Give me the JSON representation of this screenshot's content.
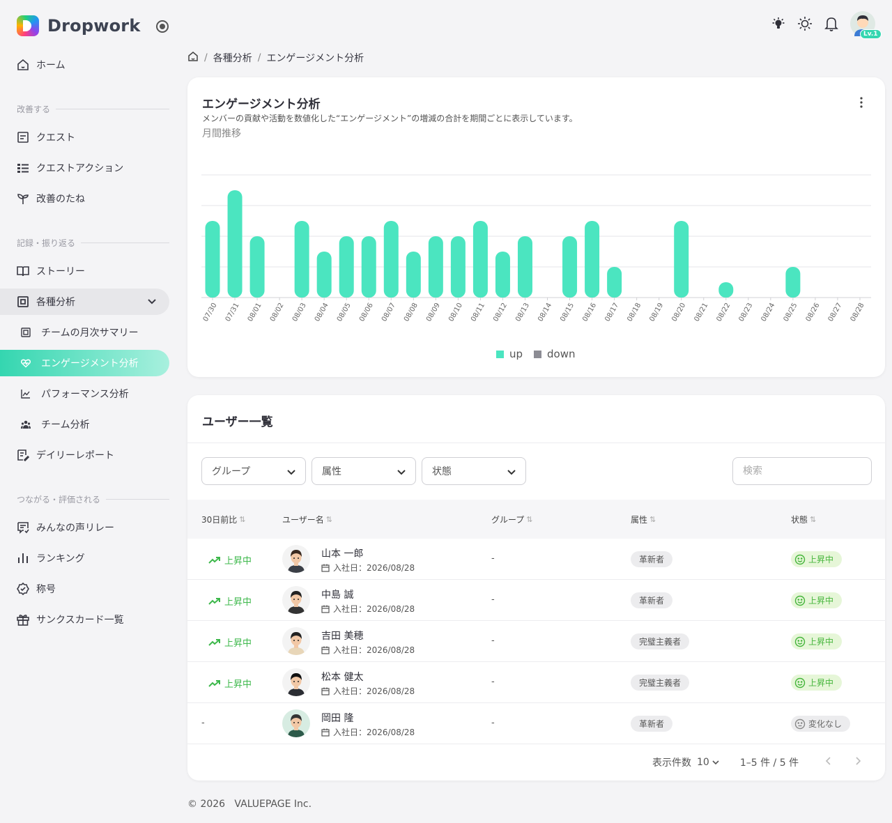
{
  "app": {
    "name": "Dropwork"
  },
  "colors": {
    "accent": "#34d6b0",
    "bar_up": "#4be5c0",
    "bar_down": "#8c8c94",
    "trend_up": "#3db84b"
  },
  "nav": {
    "home": "ホーム",
    "section_improve": "改善する",
    "quest": "クエスト",
    "quest_action": "クエストアクション",
    "seeds": "改善のたね",
    "section_record": "記録・振り返る",
    "story": "ストーリー",
    "analysis": "各種分析",
    "team_summary": "チームの月次サマリー",
    "engagement": "エンゲージメント分析",
    "performance": "パフォーマンス分析",
    "team_analysis": "チーム分析",
    "daily_report": "デイリーレポート",
    "section_connect": "つながる・評価される",
    "voice_relay": "みんなの声リレー",
    "ranking": "ランキング",
    "title_badge": "称号",
    "thanks_card": "サンクスカード一覧"
  },
  "user": {
    "level": "Lv.1"
  },
  "breadcrumb": {
    "parent": "各種分析",
    "current": "エンゲージメント分析"
  },
  "engagement_card": {
    "title": "エンゲージメント分析",
    "description": "メンバーの貢献や活動を数値化した“エンゲージメント”の増減の合計を期間ごとに表示しています。",
    "subtitle": "月間推移"
  },
  "chart_data": {
    "type": "bar",
    "categories": [
      "07/30",
      "07/31",
      "08/01",
      "08/02",
      "08/03",
      "08/04",
      "08/05",
      "08/06",
      "08/07",
      "08/08",
      "08/09",
      "08/10",
      "08/11",
      "08/12",
      "08/13",
      "08/14",
      "08/15",
      "08/16",
      "08/17",
      "08/18",
      "08/19",
      "08/20",
      "08/21",
      "08/22",
      "08/23",
      "08/24",
      "08/25",
      "08/26",
      "08/27",
      "08/28"
    ],
    "series": [
      {
        "name": "up",
        "color": "#4be5c0",
        "values": [
          5,
          7,
          4,
          0,
          5,
          3,
          4,
          4,
          5,
          3,
          4,
          4,
          5,
          3,
          4,
          0,
          4,
          5,
          2,
          0,
          0,
          5,
          0,
          1,
          0,
          0,
          2,
          0,
          0,
          0
        ]
      },
      {
        "name": "down",
        "color": "#8c8c94",
        "values": [
          0,
          0,
          0,
          0,
          0,
          0,
          0,
          0,
          0,
          0,
          0,
          0,
          0,
          0,
          0,
          0,
          0,
          0,
          0,
          0,
          0,
          0,
          0,
          0,
          0,
          0,
          0,
          0,
          0,
          0
        ]
      }
    ],
    "ylim": [
      0,
      8
    ],
    "grid": true,
    "legend": "bottom-center"
  },
  "users_card": {
    "title": "ユーザー一覧",
    "filters": {
      "group": "グループ",
      "attribute": "属性",
      "state": "状態"
    },
    "search_placeholder": "検索",
    "columns": {
      "change": "30日前比",
      "name": "ユーザー名",
      "group": "グループ",
      "attribute": "属性",
      "state": "状態"
    },
    "join_label": "入社日：",
    "rows": [
      {
        "trend": "上昇中",
        "name": "山本 一郎",
        "join": "2026/08/28",
        "group": "-",
        "attribute": "革新者",
        "state": "上昇中"
      },
      {
        "trend": "上昇中",
        "name": "中島 誠",
        "join": "2026/08/28",
        "group": "-",
        "attribute": "革新者",
        "state": "上昇中"
      },
      {
        "trend": "上昇中",
        "name": "吉田 美穂",
        "join": "2026/08/28",
        "group": "-",
        "attribute": "完璧主義者",
        "state": "上昇中"
      },
      {
        "trend": "上昇中",
        "name": "松本 健太",
        "join": "2026/08/28",
        "group": "-",
        "attribute": "完璧主義者",
        "state": "上昇中"
      },
      {
        "trend": "-",
        "name": "岡田 隆",
        "join": "2026/08/28",
        "group": "-",
        "attribute": "革新者",
        "state": "変化なし"
      }
    ],
    "pager": {
      "label": "表示件数",
      "per_page": "10",
      "range": "1–5 件 / 5 件"
    }
  },
  "footer": {
    "copyright": "© 2026   VALUEPAGE Inc."
  }
}
